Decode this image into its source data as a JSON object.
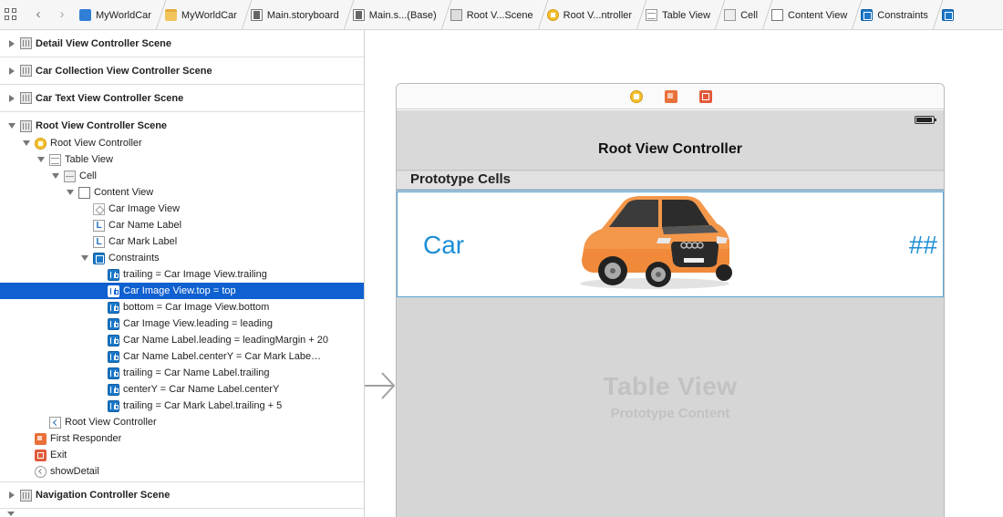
{
  "jumpbar": {
    "crumbs": [
      {
        "label": "MyWorldCar",
        "icon": "project-icon"
      },
      {
        "label": "MyWorldCar",
        "icon": "folder-icon"
      },
      {
        "label": "Main.storyboard",
        "icon": "storyboard-icon"
      },
      {
        "label": "Main.s...(Base)",
        "icon": "storyboard-icon"
      },
      {
        "label": "Root V...Scene",
        "icon": "scene-icon"
      },
      {
        "label": "Root V...ntroller",
        "icon": "view-controller-icon"
      },
      {
        "label": "Table View",
        "icon": "table-view-icon"
      },
      {
        "label": "Cell",
        "icon": "cell-icon"
      },
      {
        "label": "Content View",
        "icon": "view-icon"
      },
      {
        "label": "Constraints",
        "icon": "constraints-icon"
      }
    ]
  },
  "outline": {
    "detail_scene": "Detail View Controller Scene",
    "collection_scene": "Car Collection View Controller Scene",
    "text_scene": "Car Text View Controller Scene",
    "root_scene": "Root View Controller Scene",
    "root_vc": "Root View Controller",
    "table_view": "Table View",
    "cell": "Cell",
    "content_view": "Content View",
    "car_image_view": "Car Image View",
    "car_name_label": "Car Name Label",
    "car_mark_label": "Car Mark Label",
    "constraints": "Constraints",
    "constraint_items": [
      "trailing = Car Image View.trailing",
      "Car Image View.top = top",
      "bottom = Car Image View.bottom",
      "Car Image View.leading = leading",
      "Car Name Label.leading = leadingMargin + 20",
      "Car Name Label.centerY = Car Mark Labe…",
      "trailing = Car Name Label.trailing",
      "centerY = Car Name Label.centerY",
      "trailing = Car Mark Label.trailing + 5"
    ],
    "selected_index": 1,
    "nav_item": "Root View Controller",
    "first_responder": "First Responder",
    "exit": "Exit",
    "segue": "showDetail",
    "nav_scene": "Navigation Controller Scene"
  },
  "canvas": {
    "nav_title": "Root View Controller",
    "prototype_header": "Prototype Cells",
    "cell_car_label": "Car",
    "cell_mark_label": "##",
    "placeholder_title": "Table View",
    "placeholder_subtitle": "Prototype Content"
  },
  "colors": {
    "selection": "#0f60d0",
    "label_blue": "#1c8fd6",
    "constraint_icon": "#1b78c8",
    "vc_icon": "#f3c131"
  }
}
